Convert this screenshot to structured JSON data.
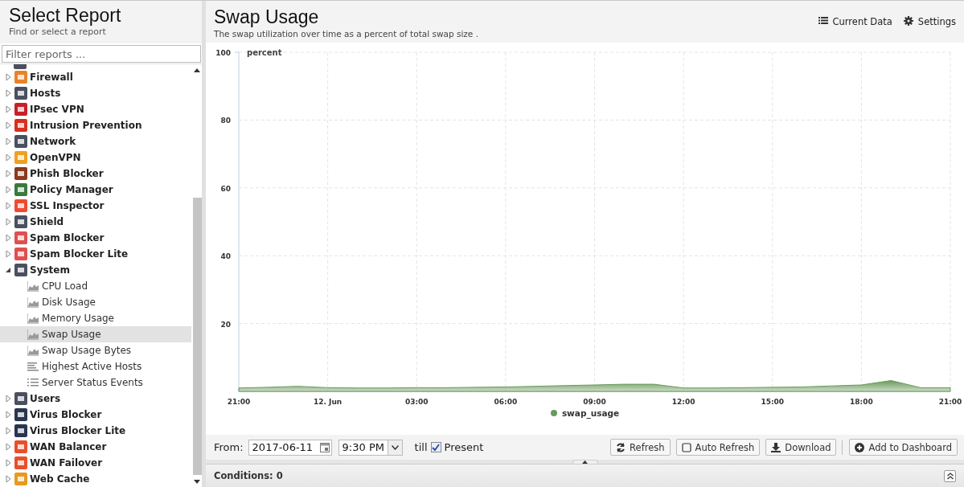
{
  "sidebar": {
    "title": "Select Report",
    "subtitle": "Find or select a report",
    "filter": {
      "placeholder": "Filter reports ..."
    },
    "items": [
      {
        "label": "Firewall",
        "color": "#e8832a",
        "expanded": false
      },
      {
        "label": "Hosts",
        "color": "#4a5060",
        "expanded": false
      },
      {
        "label": "IPsec VPN",
        "color": "#c8202a",
        "expanded": false
      },
      {
        "label": "Intrusion Prevention",
        "color": "#d8301e",
        "expanded": false
      },
      {
        "label": "Network",
        "color": "#4a5060",
        "expanded": false
      },
      {
        "label": "OpenVPN",
        "color": "#f0a020",
        "expanded": false
      },
      {
        "label": "Phish Blocker",
        "color": "#8a3a1e",
        "expanded": false
      },
      {
        "label": "Policy Manager",
        "color": "#3a7a3a",
        "expanded": false
      },
      {
        "label": "SSL Inspector",
        "color": "#f04a30",
        "expanded": false
      },
      {
        "label": "Shield",
        "color": "#4a5060",
        "expanded": false
      },
      {
        "label": "Spam Blocker",
        "color": "#e05050",
        "expanded": false
      },
      {
        "label": "Spam Blocker Lite",
        "color": "#e05050",
        "expanded": false
      },
      {
        "label": "System",
        "color": "#4a5060",
        "expanded": true,
        "children": [
          {
            "label": "CPU Load",
            "kind": "chart",
            "selected": false
          },
          {
            "label": "Disk Usage",
            "kind": "chart",
            "selected": false
          },
          {
            "label": "Memory Usage",
            "kind": "chart",
            "selected": false
          },
          {
            "label": "Swap Usage",
            "kind": "chart",
            "selected": true
          },
          {
            "label": "Swap Usage Bytes",
            "kind": "chart",
            "selected": false
          },
          {
            "label": "Highest Active Hosts",
            "kind": "bars",
            "selected": false
          },
          {
            "label": "Server Status Events",
            "kind": "list",
            "selected": false
          }
        ]
      },
      {
        "label": "Users",
        "color": "#4a5060",
        "expanded": false
      },
      {
        "label": "Virus Blocker",
        "color": "#2a3550",
        "expanded": false
      },
      {
        "label": "Virus Blocker Lite",
        "color": "#2a3550",
        "expanded": false
      },
      {
        "label": "WAN Balancer",
        "color": "#e8502a",
        "expanded": false
      },
      {
        "label": "WAN Failover",
        "color": "#e8502a",
        "expanded": false
      },
      {
        "label": "Web Cache",
        "color": "#e89a20",
        "expanded": false
      }
    ]
  },
  "report": {
    "title": "Swap Usage",
    "description": "The swap utilization over time as a percent of total swap size .",
    "actions": [
      "Current Data",
      "Settings"
    ],
    "chart_data": {
      "type": "area",
      "ylabel": "percent",
      "ylim": [
        0,
        100
      ],
      "grid": true,
      "yticks": [
        20,
        40,
        60,
        80,
        100
      ],
      "categories": [
        "21:00",
        null,
        null,
        "12. Jun",
        null,
        null,
        "03:00",
        null,
        null,
        "06:00",
        null,
        null,
        "09:00",
        null,
        null,
        "12:00",
        null,
        null,
        "15:00",
        null,
        null,
        "18:00",
        null,
        null,
        "21:00"
      ],
      "series": [
        {
          "name": "swap_usage",
          "color": "#6a9a5b",
          "values": [
            1.0,
            1.2,
            1.5,
            1.1,
            1.0,
            1.0,
            1.1,
            1.1,
            1.2,
            1.3,
            1.5,
            1.7,
            1.9,
            2.1,
            2.1,
            1.0,
            1.0,
            1.1,
            1.2,
            1.3,
            1.6,
            1.9,
            3.2,
            1.1,
            1.1
          ]
        }
      ]
    },
    "toolbar": {
      "from_label": "From:",
      "date": "2017-06-11",
      "time": "9:30 PM",
      "till_label": "till",
      "present": {
        "label": "Present",
        "checked": true
      },
      "buttons": [
        {
          "label": "Refresh",
          "kind": "refresh"
        },
        {
          "label": "Auto Refresh",
          "kind": "checkbox"
        },
        {
          "label": "Download",
          "kind": "download"
        },
        {
          "label": "Add to Dashboard",
          "kind": "add"
        }
      ]
    },
    "conditions": {
      "label": "Conditions: 0"
    }
  }
}
